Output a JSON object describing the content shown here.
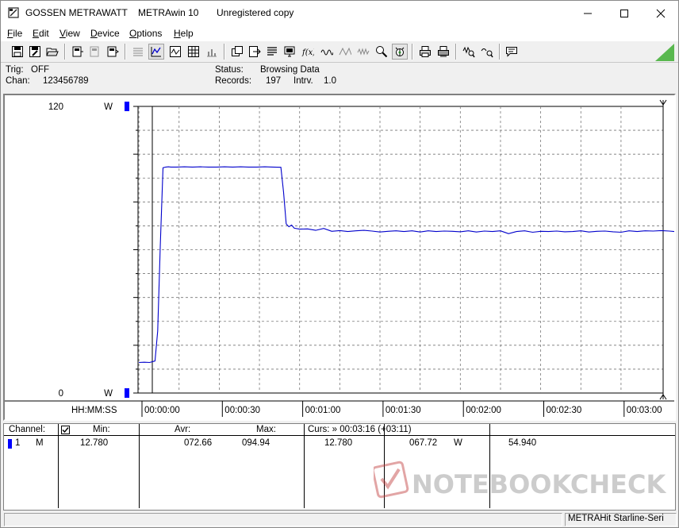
{
  "titlebar": {
    "vendor": "GOSSEN METRAWATT",
    "app_name": "METRAwin 10",
    "license": "Unregistered copy",
    "minimize_icon": "minimize-icon",
    "maximize_icon": "maximize-icon",
    "close_icon": "close-icon"
  },
  "menu": {
    "items": [
      {
        "label": "File",
        "key": "F"
      },
      {
        "label": "Edit",
        "key": "E"
      },
      {
        "label": "View",
        "key": "V"
      },
      {
        "label": "Device",
        "key": "D"
      },
      {
        "label": "Options",
        "key": "O"
      },
      {
        "label": "Help",
        "key": "H"
      }
    ]
  },
  "status": {
    "trig_label": "Trig:",
    "trig_value": "OFF",
    "chan_label": "Chan:",
    "chan_value": "123456789",
    "status_label": "Status:",
    "status_value": "Browsing Data",
    "records_label": "Records:",
    "records_value": "197",
    "interval_label": "Intrv.",
    "interval_value": "1.0"
  },
  "plot": {
    "y_top_value": "120",
    "y_top_unit": "W",
    "y_bottom_value": "0",
    "y_bottom_unit": "W",
    "x_axis_label": "HH:MM:SS",
    "x_ticks": [
      "00:00:00",
      "00:00:30",
      "00:01:00",
      "00:01:30",
      "00:02:00",
      "00:02:30",
      "00:03:00"
    ],
    "line_color": "#0000cc",
    "channel_marker_color": "#0000ff"
  },
  "chart_data": {
    "type": "line",
    "ylim": [
      0,
      120
    ],
    "ylabel": "W",
    "xlabel": "HH:MM:SS",
    "x_seconds_range": [
      -5,
      196
    ],
    "series": [
      {
        "values_x_seconds": [
          -5,
          -3,
          -1,
          1,
          2,
          3,
          4,
          5,
          6,
          7,
          9,
          12,
          15,
          18,
          21,
          24,
          27,
          30,
          33,
          36,
          39,
          42,
          45,
          48,
          49,
          50,
          51,
          52,
          53,
          55,
          58,
          61,
          64,
          67,
          70,
          73,
          76,
          79,
          82,
          85,
          88,
          91,
          94,
          97,
          100,
          103,
          106,
          109,
          112,
          115,
          118,
          121,
          124,
          127,
          130,
          133,
          136,
          139,
          142,
          145,
          148,
          151,
          154,
          157,
          160,
          163,
          166,
          169,
          172,
          175,
          178,
          181,
          184,
          187,
          190,
          193,
          196
        ],
        "values": [
          12.8,
          12.9,
          12.8,
          13.4,
          26,
          62,
          94.3,
          94.6,
          94.7,
          94.6,
          94.6,
          94.7,
          94.6,
          94.7,
          94.6,
          94.6,
          94.7,
          94.6,
          94.7,
          94.6,
          94.6,
          94.7,
          94.6,
          94.5,
          84,
          70.8,
          69.6,
          70.3,
          69.0,
          68.6,
          68.7,
          68.1,
          68.9,
          67.7,
          68.0,
          67.6,
          67.9,
          68.1,
          67.8,
          67.4,
          67.7,
          67.9,
          67.6,
          67.9,
          67.4,
          67.9,
          67.6,
          67.8,
          67.7,
          67.5,
          67.9,
          67.4,
          67.8,
          67.6,
          67.9,
          66.7,
          67.6,
          67.9,
          67.3,
          67.7,
          67.6,
          67.8,
          67.5,
          67.6,
          67.9,
          67.4,
          67.7,
          67.8,
          67.5,
          67.3,
          67.9,
          67.6,
          67.9,
          67.8,
          68.0,
          67.8,
          67.5
        ]
      }
    ]
  },
  "table": {
    "channel_header": "Channel:",
    "min_header": "Min:",
    "avr_header": "Avr:",
    "max_header": "Max:",
    "curs_header": "Curs: » 00:03:16 (+03:11)",
    "row": {
      "channel_no": "1",
      "mode": "M",
      "min": "12.780",
      "avr": "072.66",
      "max": "094.94",
      "curs_min": "12.780",
      "curs_value": "067.72",
      "curs_unit": "W",
      "curs_extra": "54.940"
    }
  },
  "statusbar": {
    "device": "METRAHit Starline-Seri"
  },
  "watermark": {
    "text": "NOTEBOOKCHECK"
  }
}
